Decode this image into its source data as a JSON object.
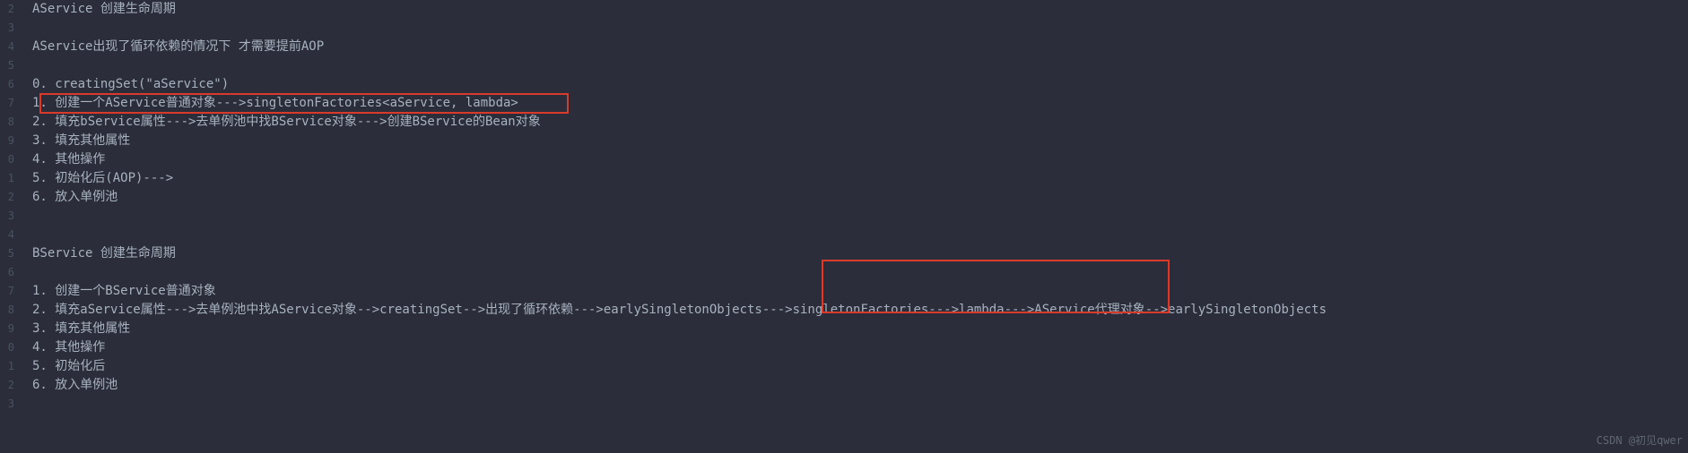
{
  "gutter": [
    "2",
    "3",
    "4",
    "5",
    "6",
    "7",
    "8",
    "9",
    "0",
    "1",
    "2",
    "3",
    "4",
    "5",
    "6",
    "7",
    "8",
    "9",
    "0",
    "1",
    "2",
    "3"
  ],
  "lines": {
    "l0": "AService 创建生命周期",
    "l1": "",
    "l2": "AService出现了循环依赖的情况下 才需要提前AOP",
    "l3": "",
    "l4": "0. creatingSet(\"aService\")",
    "l5": "1. 创建一个AService普通对象--->singletonFactories<aService, lambda>",
    "l6": "2. 填充bService属性--->去单例池中找BService对象--->创建BService的Bean对象",
    "l7": "3. 填充其他属性",
    "l8": "4. 其他操作",
    "l9": "5. 初始化后(AOP)--->",
    "l10": "6. 放入单例池",
    "l11": "",
    "l12": "",
    "l13": "BService 创建生命周期",
    "l14": "",
    "l15": "1. 创建一个BService普通对象",
    "l16": "2. 填充aService属性--->去单例池中找AService对象-->creatingSet-->出现了循环依赖--->earlySingletonObjects--->singletonFactories--->lambda--->AService代理对象-->earlySingletonObjects",
    "l17": "3. 填充其他属性",
    "l18": "4. 其他操作",
    "l19": "5. 初始化后",
    "l20": "6. 放入单例池",
    "l21": ""
  },
  "watermark": "CSDN @初见qwer"
}
